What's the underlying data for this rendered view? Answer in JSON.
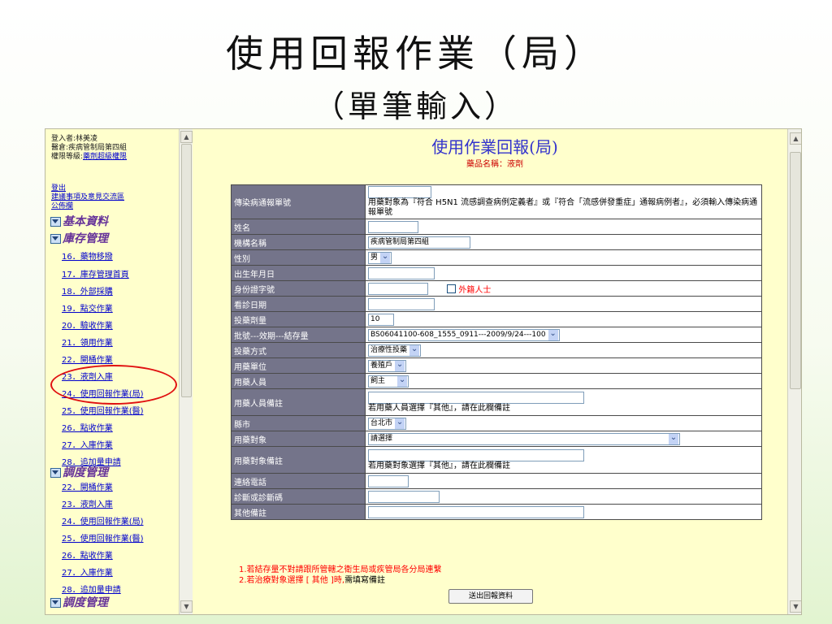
{
  "slide": {
    "title": "使用回報作業（局）",
    "subtitle": "（單筆輸入）"
  },
  "sidebar": {
    "login_user": "登入者:林美凌",
    "warehouse": "醫倉:疾病管制局第四組",
    "permission_prefix": "權限等級:",
    "permission_link": "藥劑超級權限",
    "logout": "登出",
    "suggestion": "建議事項及意見交流區",
    "bulletin": "公佈欄",
    "sections": [
      "基本資料",
      "庫存管理",
      "調度管理",
      "調度管理"
    ],
    "inventory_items": [
      "16．藥物移撥",
      "17．庫存管理首頁",
      "18．外部採購",
      "19．點交作業",
      "20．驗收作業",
      "21．領用作業",
      "22．開桶作業",
      "23．液劑入庫",
      "24．使用回報作業(局)",
      "25．使用回報作業(醫)",
      "26．點收作業",
      "27．入庫作業",
      "28．追加量申請"
    ],
    "dispatch_items": [
      "22．開桶作業",
      "23．液劑入庫",
      "24．使用回報作業(局)",
      "25．使用回報作業(醫)",
      "26．點收作業",
      "27．入庫作業",
      "28．追加量申請"
    ]
  },
  "main": {
    "title": "使用作業回報(局)",
    "drug_name": "藥品名稱：液劑",
    "fields": {
      "report_no": {
        "label": "傳染病通報單號",
        "value": "",
        "hint": "用藥對象為『符合 H5N1 流感調查病例定義者』或『符合「流感併發重症」通報病例者』，必須輸入傳染病通報單號"
      },
      "name": {
        "label": "姓名",
        "value": ""
      },
      "org": {
        "label": "機構名稱",
        "value": "疾病管制局第四組"
      },
      "gender": {
        "label": "性別",
        "value": "男"
      },
      "dob": {
        "label": "出生年月日",
        "value": ""
      },
      "id_no": {
        "label": "身份證字號",
        "value": "",
        "foreigner": "外籍人士"
      },
      "visit_date": {
        "label": "看診日期",
        "value": ""
      },
      "dosage": {
        "label": "投藥劑量",
        "value": "10"
      },
      "batch": {
        "label": "批號---效期---結存量",
        "value": "BS06041100-608_1555_0911---2009/9/24---100"
      },
      "method": {
        "label": "投藥方式",
        "value": "治療性投藥"
      },
      "unit": {
        "label": "用藥單位",
        "value": "養殖戶"
      },
      "person": {
        "label": "用藥人員",
        "value": "飼主"
      },
      "person_note": {
        "label": "用藥人員備註",
        "value": "",
        "hint": "若用藥人員選擇『其他』，請在此欄備註"
      },
      "city": {
        "label": "縣市",
        "value": "台北市"
      },
      "target": {
        "label": "用藥對象",
        "value": "請選擇"
      },
      "target_note": {
        "label": "用藥對象備註",
        "value": "",
        "hint": "若用藥對象選擇『其他』，請在此欄備註"
      },
      "phone": {
        "label": "連絡電話",
        "value": ""
      },
      "diagnosis": {
        "label": "診斷或診斷碼",
        "value": ""
      },
      "other_note": {
        "label": "其他備註",
        "value": ""
      }
    },
    "note1": "1.若結存量不對請跟所管轄之衛生局或疾管局各分局連繫",
    "note2_red": "2.若治療對象選擇 [ 其他 ]時,",
    "note2_black": "需填寫備註",
    "submit": "送出回報資料"
  },
  "colors": {
    "label_bg": "#74748a",
    "panel_bg": "#ffffcc",
    "title_blue": "#3333cc",
    "alert_red": "#ff0000",
    "highlight": "#e01010"
  }
}
